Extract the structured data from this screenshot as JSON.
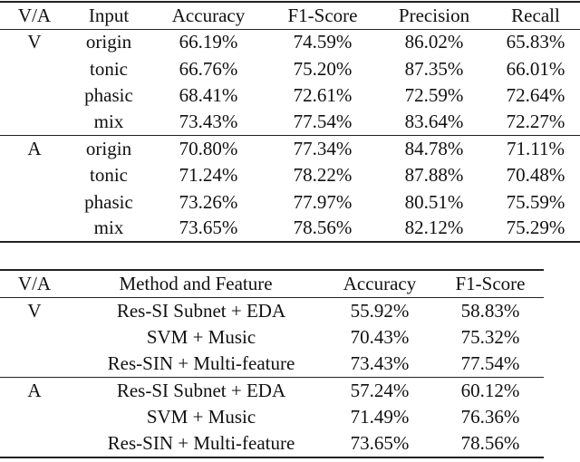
{
  "table1": {
    "headers": [
      "V/A",
      "Input",
      "Accuracy",
      "F1-Score",
      "Precision",
      "Recall"
    ],
    "groups": [
      {
        "label": "V",
        "rows": [
          {
            "input": "origin",
            "accuracy": "66.19%",
            "f1": "74.59%",
            "precision": "86.02%",
            "recall": "65.83%",
            "bold": false
          },
          {
            "input": "tonic",
            "accuracy": "66.76%",
            "f1": "75.20%",
            "precision": "87.35%",
            "recall": "66.01%",
            "bold": false
          },
          {
            "input": "phasic",
            "accuracy": "68.41%",
            "f1": "72.61%",
            "precision": "72.59%",
            "recall": "72.64%",
            "bold": false
          },
          {
            "input": "mix",
            "accuracy": "73.43%",
            "f1": "77.54%",
            "precision": "83.64%",
            "recall": "72.27%",
            "bold": true
          }
        ]
      },
      {
        "label": "A",
        "rows": [
          {
            "input": "origin",
            "accuracy": "70.80%",
            "f1": "77.34%",
            "precision": "84.78%",
            "recall": "71.11%",
            "bold": false
          },
          {
            "input": "tonic",
            "accuracy": "71.24%",
            "f1": "78.22%",
            "precision": "87.88%",
            "recall": "70.48%",
            "bold": false
          },
          {
            "input": "phasic",
            "accuracy": "73.26%",
            "f1": "77.97%",
            "precision": "80.51%",
            "recall": "75.59%",
            "bold": false
          },
          {
            "input": "mix",
            "accuracy": "73.65%",
            "f1": "78.56%",
            "precision": "82.12%",
            "recall": "75.29%",
            "bold": true
          }
        ]
      }
    ]
  },
  "table2": {
    "headers": [
      "V/A",
      "Method and Feature",
      "Accuracy",
      "F1-Score"
    ],
    "groups": [
      {
        "label": "V",
        "rows": [
          {
            "method": "Res-SI Subnet + EDA",
            "accuracy": "55.92%",
            "f1": "58.83%",
            "bold": false
          },
          {
            "method": "SVM + Music",
            "accuracy": "70.43%",
            "f1": "75.32%",
            "bold": false
          },
          {
            "method": "Res-SIN + Multi-feature",
            "accuracy": "73.43%",
            "f1": "77.54%",
            "bold": true
          }
        ]
      },
      {
        "label": "A",
        "rows": [
          {
            "method": "Res-SI Subnet + EDA",
            "accuracy": "57.24%",
            "f1": "60.12%",
            "bold": false
          },
          {
            "method": "SVM + Music",
            "accuracy": "71.49%",
            "f1": "76.36%",
            "bold": false
          },
          {
            "method": "Res-SIN + Multi-feature",
            "accuracy": "73.65%",
            "f1": "78.56%",
            "bold": true
          }
        ]
      }
    ]
  }
}
